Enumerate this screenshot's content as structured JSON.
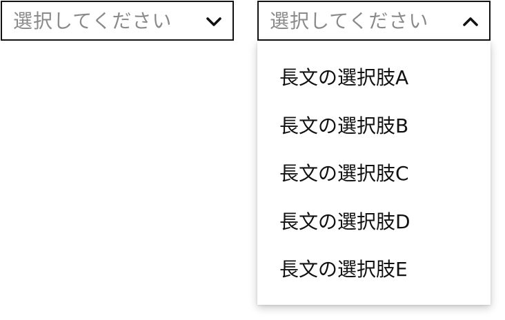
{
  "select_closed": {
    "placeholder": "選択してください",
    "icon": "chevron-down-icon",
    "state": "closed"
  },
  "select_open": {
    "placeholder": "選択してください",
    "icon": "chevron-up-icon",
    "state": "open",
    "options": [
      {
        "label": "長文の選択肢A"
      },
      {
        "label": "長文の選択肢B"
      },
      {
        "label": "長文の選択肢C"
      },
      {
        "label": "長文の選択肢D"
      },
      {
        "label": "長文の選択肢E"
      }
    ]
  },
  "colors": {
    "border": "#111111",
    "placeholder": "#8a8a8a",
    "text": "#111111",
    "background": "#ffffff"
  }
}
